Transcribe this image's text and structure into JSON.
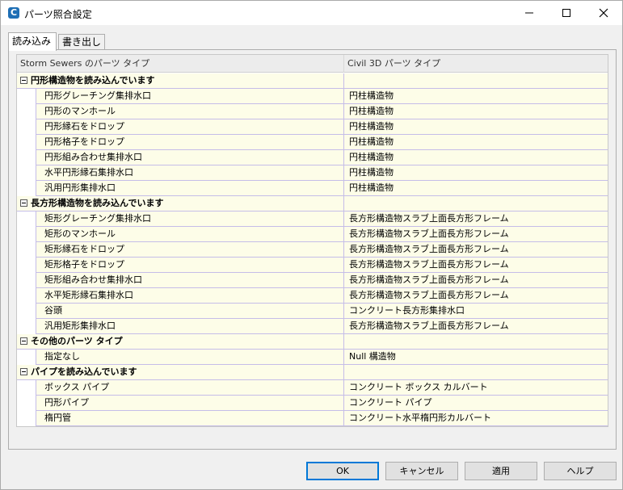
{
  "window": {
    "title": "パーツ照合設定",
    "app_icon": "C"
  },
  "tabs": [
    {
      "label": "読み込み",
      "active": true
    },
    {
      "label": "書き出し",
      "active": false
    }
  ],
  "grid": {
    "headers": [
      "Storm Sewers のパーツ タイプ",
      "Civil 3D パーツ タイプ"
    ],
    "rows": [
      {
        "type": "group",
        "c1": "円形構造物を読み込んでいます",
        "c2": ""
      },
      {
        "type": "child",
        "c1": "円形グレーチング集排水口",
        "c2": "円柱構造物"
      },
      {
        "type": "child",
        "c1": "円形のマンホール",
        "c2": "円柱構造物"
      },
      {
        "type": "child",
        "c1": "円形縁石をドロップ",
        "c2": "円柱構造物"
      },
      {
        "type": "child",
        "c1": "円形格子をドロップ",
        "c2": "円柱構造物"
      },
      {
        "type": "child",
        "c1": "円形組み合わせ集排水口",
        "c2": "円柱構造物"
      },
      {
        "type": "child",
        "c1": "水平円形縁石集排水口",
        "c2": "円柱構造物"
      },
      {
        "type": "child",
        "c1": "汎用円形集排水口",
        "c2": "円柱構造物"
      },
      {
        "type": "group",
        "c1": "長方形構造物を読み込んでいます",
        "c2": ""
      },
      {
        "type": "child",
        "c1": "矩形グレーチング集排水口",
        "c2": "長方形構造物スラブ上面長方形フレーム"
      },
      {
        "type": "child",
        "c1": "矩形のマンホール",
        "c2": "長方形構造物スラブ上面長方形フレーム"
      },
      {
        "type": "child",
        "c1": "矩形縁石をドロップ",
        "c2": "長方形構造物スラブ上面長方形フレーム"
      },
      {
        "type": "child",
        "c1": "矩形格子をドロップ",
        "c2": "長方形構造物スラブ上面長方形フレーム"
      },
      {
        "type": "child",
        "c1": "矩形組み合わせ集排水口",
        "c2": "長方形構造物スラブ上面長方形フレーム"
      },
      {
        "type": "child",
        "c1": "水平矩形縁石集排水口",
        "c2": "長方形構造物スラブ上面長方形フレーム"
      },
      {
        "type": "child",
        "c1": "谷頭",
        "c2": "コンクリート長方形集排水口"
      },
      {
        "type": "child",
        "c1": "汎用矩形集排水口",
        "c2": "長方形構造物スラブ上面長方形フレーム"
      },
      {
        "type": "group",
        "c1": "その他のパーツ タイプ",
        "c2": ""
      },
      {
        "type": "child",
        "c1": "指定なし",
        "c2": "Null 構造物"
      },
      {
        "type": "group",
        "c1": "パイプを読み込んでいます",
        "c2": ""
      },
      {
        "type": "child",
        "c1": "ボックス パイプ",
        "c2": "コンクリート ボックス カルバート"
      },
      {
        "type": "child",
        "c1": "円形パイプ",
        "c2": "コンクリート パイプ"
      },
      {
        "type": "child",
        "c1": "楕円管",
        "c2": "コンクリート水平楕円形カルバート"
      }
    ]
  },
  "buttons": {
    "ok": "OK",
    "cancel": "キャンセル",
    "apply": "適用",
    "help": "ヘルプ"
  },
  "colors": {
    "row_bg": "#fdfde8",
    "grid_line": "#c5bde8",
    "default_button_border": "#0078d7"
  }
}
